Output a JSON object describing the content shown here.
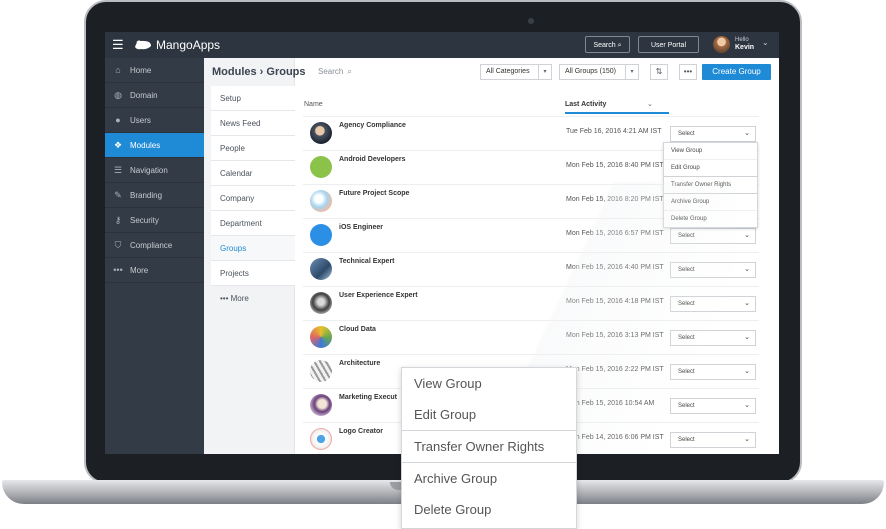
{
  "topbar": {
    "logo_text": "MangoApps",
    "search_label": "Search",
    "user_portal_label": "User Portal",
    "hello_label": "Hello",
    "user_name": "Kevin"
  },
  "sidebar": {
    "items": [
      {
        "label": "Home",
        "icon": "home-icon"
      },
      {
        "label": "Domain",
        "icon": "globe-icon"
      },
      {
        "label": "Users",
        "icon": "user-icon"
      },
      {
        "label": "Modules",
        "icon": "modules-icon",
        "active": true
      },
      {
        "label": "Navigation",
        "icon": "list-icon"
      },
      {
        "label": "Branding",
        "icon": "brush-icon"
      },
      {
        "label": "Security",
        "icon": "key-icon"
      },
      {
        "label": "Compliance",
        "icon": "shield-icon"
      },
      {
        "label": "More",
        "icon": "dots-icon"
      }
    ]
  },
  "page": {
    "title": "Modules › Groups",
    "search_placeholder": "Search"
  },
  "subnav": {
    "items": [
      "Setup",
      "News Feed",
      "People",
      "Calendar",
      "Company",
      "Department",
      "Groups",
      "Projects"
    ],
    "more_label": "More",
    "active": "Groups"
  },
  "toolbar": {
    "category_filter": "All Categories",
    "group_filter": "All Groups (150)",
    "create_label": "Create Group"
  },
  "table": {
    "col_name": "Name",
    "col_activity": "Last Activity",
    "select_label": "Select",
    "rows": [
      {
        "name": "Agency Compliance",
        "date": "Tue Feb 16, 2016 4:21 AM IST"
      },
      {
        "name": "Android Developers",
        "date": "Mon Feb 15, 2016 8:40 PM IST"
      },
      {
        "name": "Future Project Scope",
        "date": "Mon Feb 15, 2016 8:20 PM IST"
      },
      {
        "name": "iOS Engineer",
        "date": "Mon Feb 15, 2016 6:57 PM IST"
      },
      {
        "name": "Technical Expert",
        "date": "Mon Feb 15, 2016 4:40 PM IST"
      },
      {
        "name": "User Experience Expert",
        "date": "Mon Feb 15, 2016 4:18 PM IST"
      },
      {
        "name": "Cloud Data",
        "date": "Mon Feb 15, 2016 3:13 PM IST"
      },
      {
        "name": "Architecture",
        "date": "Mon Feb 15, 2016 2:22 PM IST"
      },
      {
        "name": "Marketing Execut",
        "date": "Mon Feb 15, 2016 10:54 AM"
      },
      {
        "name": "Logo Creator",
        "date": "Mon Feb 14, 2016 6:06 PM IST"
      }
    ]
  },
  "row_menu": {
    "items": [
      "View Group",
      "Edit Group",
      "Transfer Owner Rights",
      "Archive Group",
      "Delete Group"
    ]
  },
  "colors": {
    "accent": "#1f8ad6",
    "topbar": "#2d3540",
    "sidebar": "#333b46"
  }
}
